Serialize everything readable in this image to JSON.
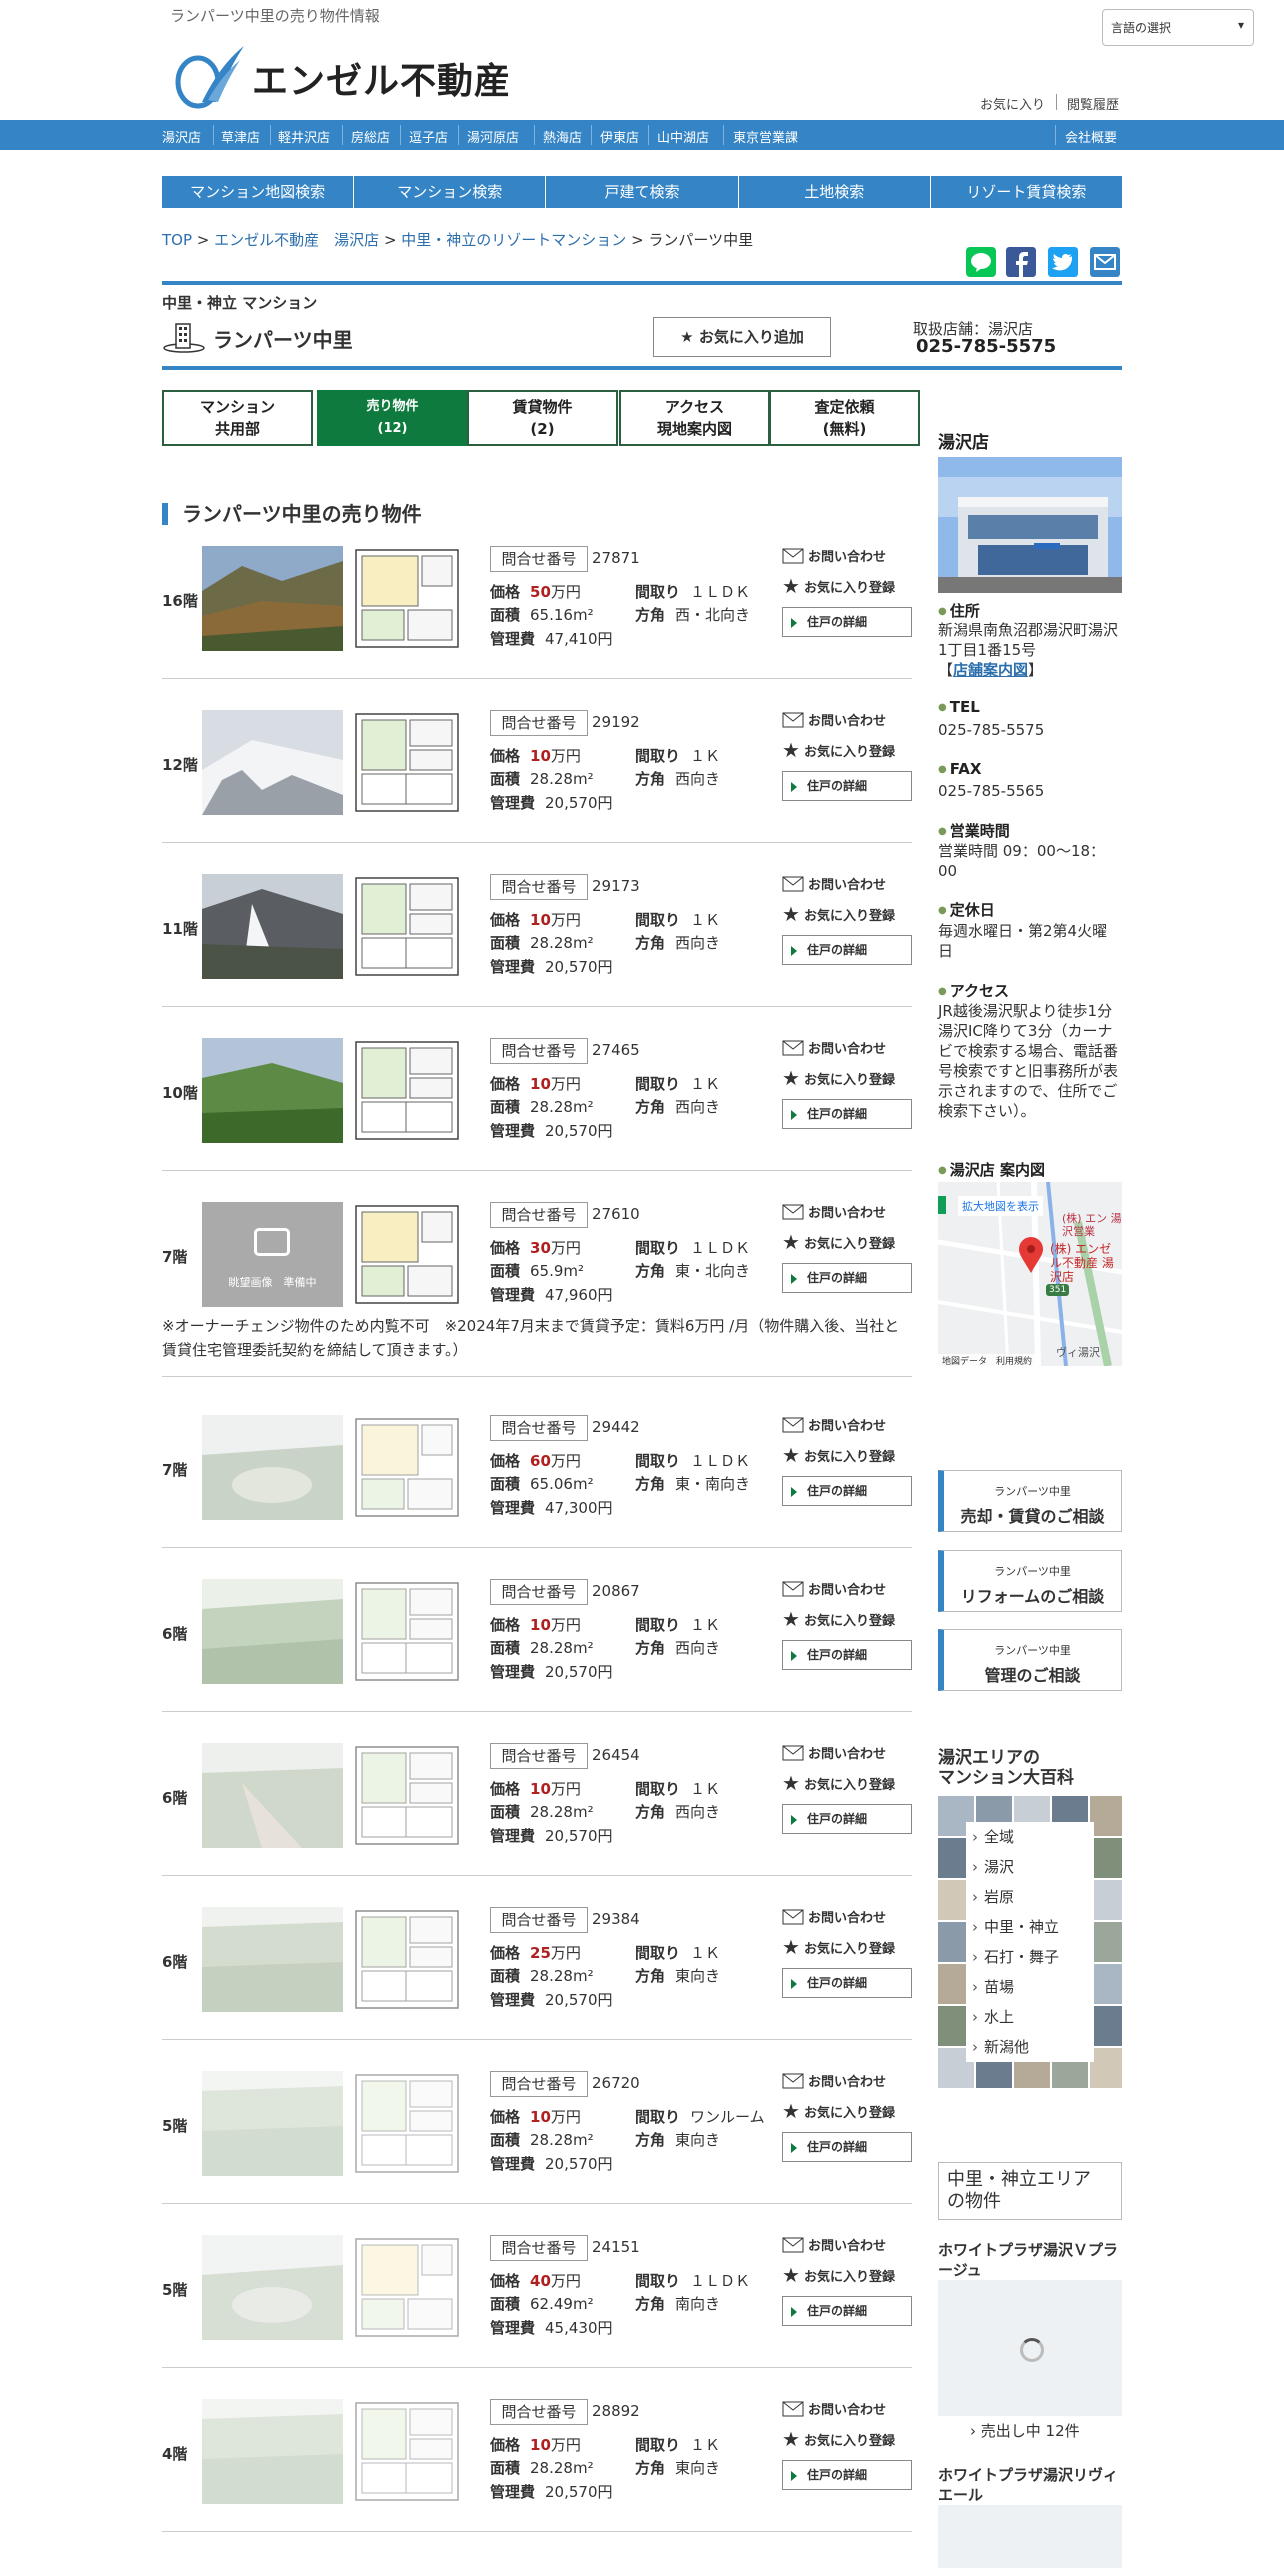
{
  "header": {
    "tagline": "ランパーツ中里の売り物件情報",
    "language_select": "言語の選択",
    "logo_text": "エンゼル不動産",
    "favorites": "お気に入り",
    "history": "閲覧履歴"
  },
  "stores_nav": [
    "湯沢店",
    "草津店",
    "軽井沢店",
    "房総店",
    "逗子店",
    "湯河原店",
    "熱海店",
    "伊東店",
    "山中湖店",
    "東京営業課"
  ],
  "company": "会社概要",
  "search_nav": [
    "マンション地図検索",
    "マンション検索",
    "戸建て検索",
    "土地検索",
    "リゾート賃貸検索"
  ],
  "breadcrumb": [
    "TOP",
    "エンゼル不動産　湯沢店",
    "中里・神立のリゾートマンション",
    "ランパーツ中里"
  ],
  "building": {
    "area": "中里・神立 マンション",
    "name": "ランパーツ中里",
    "fav_button": "お気に入り追加",
    "store_label": "取扱店舗：湯沢店",
    "store_tel": "025-785-5575"
  },
  "tabs": [
    {
      "l1": "マンション",
      "l2": "共用部"
    },
    {
      "l1": "売り物件",
      "l2": "(12)"
    },
    {
      "l1": "賃貸物件",
      "l2": "(2)"
    },
    {
      "l1": "アクセス",
      "l2": "現地案内図"
    },
    {
      "l1": "査定依頼",
      "l2": "(無料)"
    }
  ],
  "section_title": "ランパーツ中里の売り物件",
  "labels": {
    "inquiry_no": "問合せ番号",
    "price": "価格",
    "layout": "間取り",
    "area": "面積",
    "direction": "方角",
    "fee": "管理費",
    "man": "万円",
    "contact": "お問い合わせ",
    "add_fav": "お気に入り登録",
    "detail": "住戸の詳細",
    "photo_pending": "眺望画像　準備中"
  },
  "listings": [
    {
      "floor": "16階",
      "no": "27871",
      "price": "50",
      "layout": "１ＬＤＫ",
      "area": "65.16m²",
      "dir": "西・北向き",
      "fee": "47,410円",
      "photo": "autumn"
    },
    {
      "floor": "12階",
      "no": "29192",
      "price": "10",
      "layout": "１Ｋ",
      "area": "28.28m²",
      "dir": "西向き",
      "fee": "20,570円",
      "photo": "snow"
    },
    {
      "floor": "11階",
      "no": "29173",
      "price": "10",
      "layout": "１Ｋ",
      "area": "28.28m²",
      "dir": "西向き",
      "fee": "20,570円",
      "photo": "ski"
    },
    {
      "floor": "10階",
      "no": "27465",
      "price": "10",
      "layout": "１Ｋ",
      "area": "28.28m²",
      "dir": "西向き",
      "fee": "20,570円",
      "photo": "green"
    },
    {
      "floor": "7階",
      "no": "27610",
      "price": "30",
      "layout": "１ＬＤＫ",
      "area": "65.9m²",
      "dir": "東・北向き",
      "fee": "47,960円",
      "photo": "none",
      "note": "※オーナーチェンジ物件のため内覧不可　※2024年7月末まで賃貸予定：賃料6万円 /月（物件購入後、当社と賃貸住宅管理委託契約を締結して頂きます。）"
    },
    {
      "floor": "7階",
      "no": "29442",
      "price": "60",
      "layout": "１ＬＤＫ",
      "area": "65.06m²",
      "dir": "東・南向き",
      "fee": "47,300円",
      "photo": "field"
    },
    {
      "floor": "6階",
      "no": "20867",
      "price": "10",
      "layout": "１Ｋ",
      "area": "28.28m²",
      "dir": "西向き",
      "fee": "20,570円",
      "photo": "forest"
    },
    {
      "floor": "6階",
      "no": "26454",
      "price": "10",
      "layout": "１Ｋ",
      "area": "28.28m²",
      "dir": "西向き",
      "fee": "20,570円",
      "photo": "slope"
    },
    {
      "floor": "6階",
      "no": "29384",
      "price": "25",
      "layout": "１Ｋ",
      "area": "28.28m²",
      "dir": "東向き",
      "fee": "20,570円",
      "photo": "trees"
    },
    {
      "floor": "5階",
      "no": "26720",
      "price": "10",
      "layout": "ワンルーム",
      "area": "28.28m²",
      "dir": "東向き",
      "fee": "20,570円",
      "photo": "trees"
    },
    {
      "floor": "5階",
      "no": "24151",
      "price": "40",
      "layout": "１ＬＤＫ",
      "area": "62.49m²",
      "dir": "南向き",
      "fee": "45,430円",
      "photo": "field"
    },
    {
      "floor": "4階",
      "no": "28892",
      "price": "10",
      "layout": "１Ｋ",
      "area": "28.28m²",
      "dir": "東向き",
      "fee": "20,570円",
      "photo": "trees"
    }
  ],
  "sidebar": {
    "store_title": "湯沢店",
    "address_h": "住所",
    "address": "新潟県南魚沼郡湯沢町湯沢1丁目1番15号",
    "guide_link": "店舗案内図",
    "tel_h": "TEL",
    "tel": "025-785-5575",
    "fax_h": "FAX",
    "fax": "025-785-5565",
    "hours_h": "営業時間",
    "hours": "営業時間 09：00～18：00",
    "closed_h": "定休日",
    "closed": "毎週水曜日・第2第4火曜日",
    "access_h": "アクセス",
    "access": "JR越後湯沢駅より徒歩1分\n湯沢IC降りて3分（カーナビで検索する場合、電話番号検索ですと旧事務所が表示されますので、住所でご検索下さい）。",
    "map_h": "湯沢店 案内図",
    "map_link": "拡大地図を表示",
    "map_pin": "(株) エンゼル不動産 湯沢店",
    "map_label2": "(株) エン 湯沢営業",
    "map_copy": "地図データ　利用規約",
    "map_route": "351",
    "map_poi": "ヴィ湯沢",
    "consult": [
      {
        "a": "ランパーツ中里",
        "b": "売却・賃貸のご相談"
      },
      {
        "a": "ランパーツ中里",
        "b": "リフォームのご相談"
      },
      {
        "a": "ランパーツ中里",
        "b": "管理のご相談"
      }
    ],
    "ency_title": "湯沢エリアの\nマンション大百科",
    "ency_items": [
      "全域",
      "湯沢",
      "岩原",
      "中里・神立",
      "石打・舞子",
      "苗場",
      "水上",
      "新潟他"
    ],
    "area_props_title": "中里・神立エリア\nの物件",
    "prop1_name": "ホワイトプラザ湯沢Ｖプラージュ",
    "prop1_count": "売出し中 12件",
    "prop2_name": "ホワイトプラザ湯沢リヴィエール"
  },
  "colors": {
    "brand_blue": "#3585c6",
    "tab_active": "#0f7a3d",
    "price_red": "#b02020"
  }
}
